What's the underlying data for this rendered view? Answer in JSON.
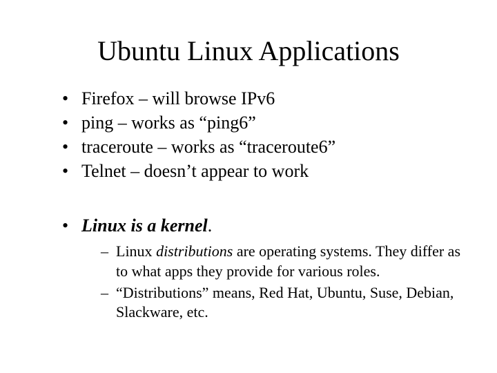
{
  "title": "Ubuntu Linux Applications",
  "bullets": [
    "Firefox – will browse IPv6",
    "ping – works as “ping6”",
    "traceroute – works as “traceroute6”",
    "Telnet – doesn’t appear to work"
  ],
  "kernel": {
    "pre": "Linux is a kernel",
    "dot": "."
  },
  "sub": [
    {
      "pre": "Linux ",
      "em": "distributions",
      "post": " are operating systems. They differ as to what apps they provide for various roles."
    },
    {
      "text": "“Distributions” means, Red Hat, Ubuntu, Suse, Debian, Slackware, etc."
    }
  ]
}
